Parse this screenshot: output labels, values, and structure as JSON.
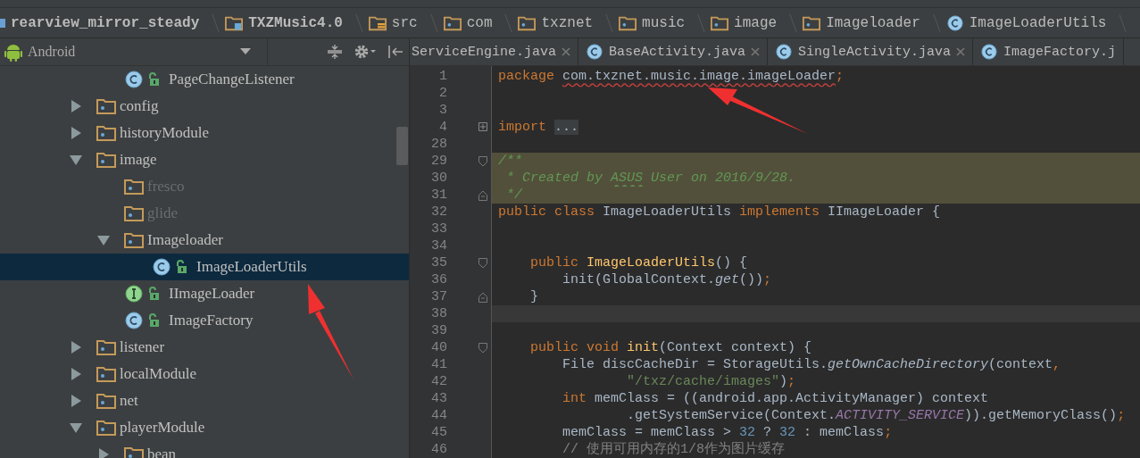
{
  "breadcrumb": [
    {
      "label": "rearview_mirror_steady",
      "kind": "module"
    },
    {
      "label": "TXZMusic4.0",
      "kind": "module-folder"
    },
    {
      "label": "src",
      "kind": "source-folder"
    },
    {
      "label": "com",
      "kind": "package"
    },
    {
      "label": "txznet",
      "kind": "package"
    },
    {
      "label": "music",
      "kind": "package"
    },
    {
      "label": "image",
      "kind": "package"
    },
    {
      "label": "Imageloader",
      "kind": "package"
    },
    {
      "label": "ImageLoaderUtils",
      "kind": "class"
    }
  ],
  "project_view": {
    "mode": "Android"
  },
  "tabs": [
    {
      "label": "ServiceEngine.java",
      "icon": false,
      "closable": true,
      "selected": false
    },
    {
      "label": "BaseActivity.java",
      "icon": true,
      "closable": true,
      "selected": false
    },
    {
      "label": "SingleActivity.java",
      "icon": true,
      "closable": true,
      "selected": false
    },
    {
      "label": "ImageFactory.j",
      "icon": true,
      "closable": false,
      "selected": false
    }
  ],
  "tree": {
    "continued_children": [
      {
        "label": "PageChangeListener",
        "kind": "class",
        "selected": false
      }
    ],
    "items": [
      {
        "label": "config",
        "kind": "folder",
        "expanded": false,
        "dimmed": false,
        "selected": false
      },
      {
        "label": "historyModule",
        "kind": "folder",
        "expanded": false,
        "dimmed": false,
        "selected": false
      },
      {
        "label": "image",
        "kind": "folder",
        "expanded": true,
        "dimmed": false,
        "selected": false,
        "children": [
          {
            "label": "fresco",
            "kind": "folder",
            "dimmed": true,
            "selected": false
          },
          {
            "label": "glide",
            "kind": "folder",
            "dimmed": true,
            "selected": false
          },
          {
            "label": "Imageloader",
            "kind": "folder",
            "expanded": true,
            "dimmed": false,
            "selected": false,
            "children": [
              {
                "label": "ImageLoaderUtils",
                "kind": "class",
                "selected": true
              }
            ]
          },
          {
            "label": "IImageLoader",
            "kind": "interface",
            "selected": false
          },
          {
            "label": "ImageFactory",
            "kind": "class",
            "selected": false
          }
        ]
      },
      {
        "label": "listener",
        "kind": "folder",
        "expanded": false,
        "dimmed": false,
        "selected": false
      },
      {
        "label": "localModule",
        "kind": "folder",
        "expanded": false,
        "dimmed": false,
        "selected": false
      },
      {
        "label": "net",
        "kind": "folder",
        "expanded": false,
        "dimmed": false,
        "selected": false
      },
      {
        "label": "playerModule",
        "kind": "folder",
        "expanded": true,
        "dimmed": false,
        "selected": false,
        "children": [
          {
            "label": "bean",
            "kind": "folder",
            "expanded": false,
            "dimmed": false,
            "selected": false
          }
        ]
      }
    ]
  },
  "editor": {
    "lines": [
      {
        "number": "1",
        "tokens": [
          {
            "text": "package ",
            "kind": "keyword"
          },
          {
            "text": "com.txznet.music.image.imageLoader",
            "kind": "error"
          },
          {
            "text": ";",
            "kind": "keyword"
          }
        ]
      },
      {
        "number": "2"
      },
      {
        "number": "3"
      },
      {
        "number": "4",
        "collapsed": true,
        "tokens": [
          {
            "text": "import ",
            "kind": "keyword"
          },
          {
            "text": "...",
            "kind": "folded"
          }
        ]
      },
      {
        "number": "28"
      },
      {
        "number": "29",
        "fold_start": true,
        "highlighted": true,
        "tokens": [
          {
            "text": "/**",
            "kind": "comment"
          }
        ]
      },
      {
        "number": "30",
        "highlighted": true,
        "tokens": [
          {
            "text": " * Created by ",
            "kind": "comment"
          },
          {
            "text": "ASUS",
            "kind": "comment-typo"
          },
          {
            "text": " User on 2016/9/28.",
            "kind": "comment"
          }
        ]
      },
      {
        "number": "31",
        "fold_end": true,
        "highlighted": true,
        "tokens": [
          {
            "text": " */",
            "kind": "comment"
          }
        ]
      },
      {
        "number": "32",
        "tokens": [
          {
            "text": "public class",
            "kind": "keyword"
          },
          {
            "text": " ImageLoaderUtils ",
            "kind": "plain"
          },
          {
            "text": "implements",
            "kind": "keyword"
          },
          {
            "text": " IImageLoader {",
            "kind": "plain"
          }
        ]
      },
      {
        "number": "33"
      },
      {
        "number": "34"
      },
      {
        "number": "35",
        "fold_start": true,
        "tokens": [
          {
            "text": "    public ",
            "kind": "keyword"
          },
          {
            "text": "ImageLoaderUtils",
            "kind": "method"
          },
          {
            "text": "() {",
            "kind": "plain"
          }
        ]
      },
      {
        "number": "36",
        "tokens": [
          {
            "text": "        init(GlobalContext.",
            "kind": "plain"
          },
          {
            "text": "get",
            "kind": "static"
          },
          {
            "text": "())",
            "kind": "plain"
          },
          {
            "text": ";",
            "kind": "keyword"
          }
        ]
      },
      {
        "number": "37",
        "fold_end": true,
        "tokens": [
          {
            "text": "    }",
            "kind": "plain"
          }
        ]
      },
      {
        "number": "38",
        "current": true
      },
      {
        "number": "39"
      },
      {
        "number": "40",
        "fold_start": true,
        "tokens": [
          {
            "text": "    public void ",
            "kind": "keyword"
          },
          {
            "text": "init",
            "kind": "method"
          },
          {
            "text": "(Context context) {",
            "kind": "plain"
          }
        ]
      },
      {
        "number": "41",
        "tokens": [
          {
            "text": "        File discCacheDir = StorageUtils.",
            "kind": "plain"
          },
          {
            "text": "getOwnCacheDirectory",
            "kind": "static"
          },
          {
            "text": "(context",
            "kind": "plain"
          },
          {
            "text": ",",
            "kind": "keyword"
          }
        ]
      },
      {
        "number": "42",
        "tokens": [
          {
            "text": "                \"/txz/cache/images\"",
            "kind": "string"
          },
          {
            "text": ")",
            "kind": "plain"
          },
          {
            "text": ";",
            "kind": "keyword"
          }
        ]
      },
      {
        "number": "43",
        "tokens": [
          {
            "text": "        int",
            "kind": "keyword"
          },
          {
            "text": " memClass = ((android.app.ActivityManager) context",
            "kind": "plain"
          }
        ]
      },
      {
        "number": "44",
        "tokens": [
          {
            "text": "                .getSystemService(Context.",
            "kind": "plain"
          },
          {
            "text": "ACTIVITY_SERVICE",
            "kind": "constant"
          },
          {
            "text": ")).getMemoryClass()",
            "kind": "plain"
          },
          {
            "text": ";",
            "kind": "keyword"
          }
        ]
      },
      {
        "number": "45",
        "tokens": [
          {
            "text": "        memClass = memClass > ",
            "kind": "plain"
          },
          {
            "text": "32",
            "kind": "number"
          },
          {
            "text": " ? ",
            "kind": "plain"
          },
          {
            "text": "32",
            "kind": "number"
          },
          {
            "text": " : memClass",
            "kind": "plain"
          },
          {
            "text": ";",
            "kind": "keyword"
          }
        ]
      },
      {
        "number": "46",
        "tokens": [
          {
            "text": "        // 使用可用内存的1/8作为图片缓存",
            "kind": "line-comment"
          }
        ]
      }
    ]
  }
}
